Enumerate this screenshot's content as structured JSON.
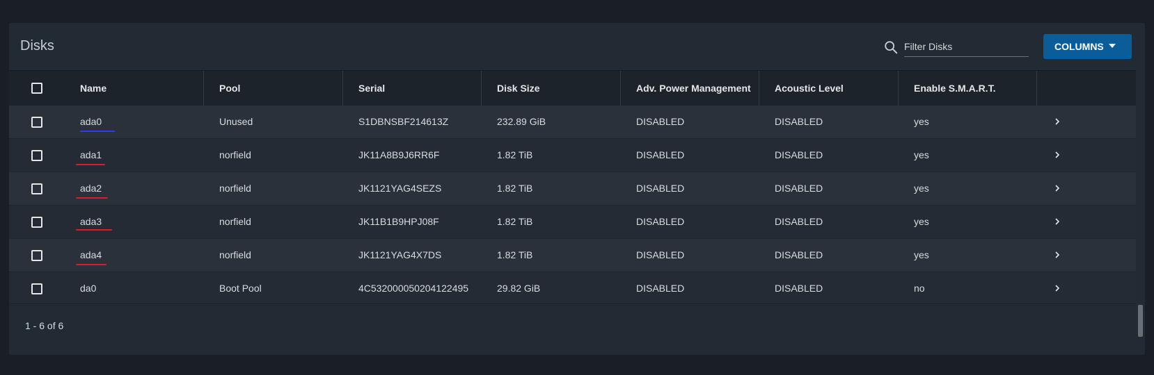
{
  "header": {
    "title": "Disks",
    "filter_placeholder": "Filter Disks",
    "columns_label": "COLUMNS"
  },
  "table": {
    "columns": [
      "Name",
      "Pool",
      "Serial",
      "Disk Size",
      "Adv. Power Management",
      "Acoustic Level",
      "Enable S.M.A.R.T."
    ],
    "rows": [
      {
        "name": "ada0",
        "pool": "Unused",
        "serial": "S1DBNSBF214613Z",
        "size": "232.89 GiB",
        "apm": "DISABLED",
        "acoustic": "DISABLED",
        "smart": "yes"
      },
      {
        "name": "ada1",
        "pool": "norfield",
        "serial": "JK11A8B9J6RR6F",
        "size": "1.82 TiB",
        "apm": "DISABLED",
        "acoustic": "DISABLED",
        "smart": "yes"
      },
      {
        "name": "ada2",
        "pool": "norfield",
        "serial": "JK1121YAG4SEZS",
        "size": "1.82 TiB",
        "apm": "DISABLED",
        "acoustic": "DISABLED",
        "smart": "yes"
      },
      {
        "name": "ada3",
        "pool": "norfield",
        "serial": "JK11B1B9HPJ08F",
        "size": "1.82 TiB",
        "apm": "DISABLED",
        "acoustic": "DISABLED",
        "smart": "yes"
      },
      {
        "name": "ada4",
        "pool": "norfield",
        "serial": "JK1121YAG4X7DS",
        "size": "1.82 TiB",
        "apm": "DISABLED",
        "acoustic": "DISABLED",
        "smart": "yes"
      },
      {
        "name": "da0",
        "pool": "Boot Pool",
        "serial": "4C532000050204122495",
        "size": "29.82 GiB",
        "apm": "DISABLED",
        "acoustic": "DISABLED",
        "smart": "no"
      }
    ]
  },
  "footer": {
    "range_label": "1 - 6 of 6"
  },
  "annotations": {
    "row_markings": [
      "blue-underline",
      "red-underline",
      "red-underline",
      "red-underline",
      "red-underline",
      "none"
    ],
    "colors": {
      "blue": "#2b3cff",
      "red": "#e0192c"
    }
  },
  "colors": {
    "accent": "#0a5d98",
    "background": "#1a1f27",
    "card": "#222a33"
  }
}
